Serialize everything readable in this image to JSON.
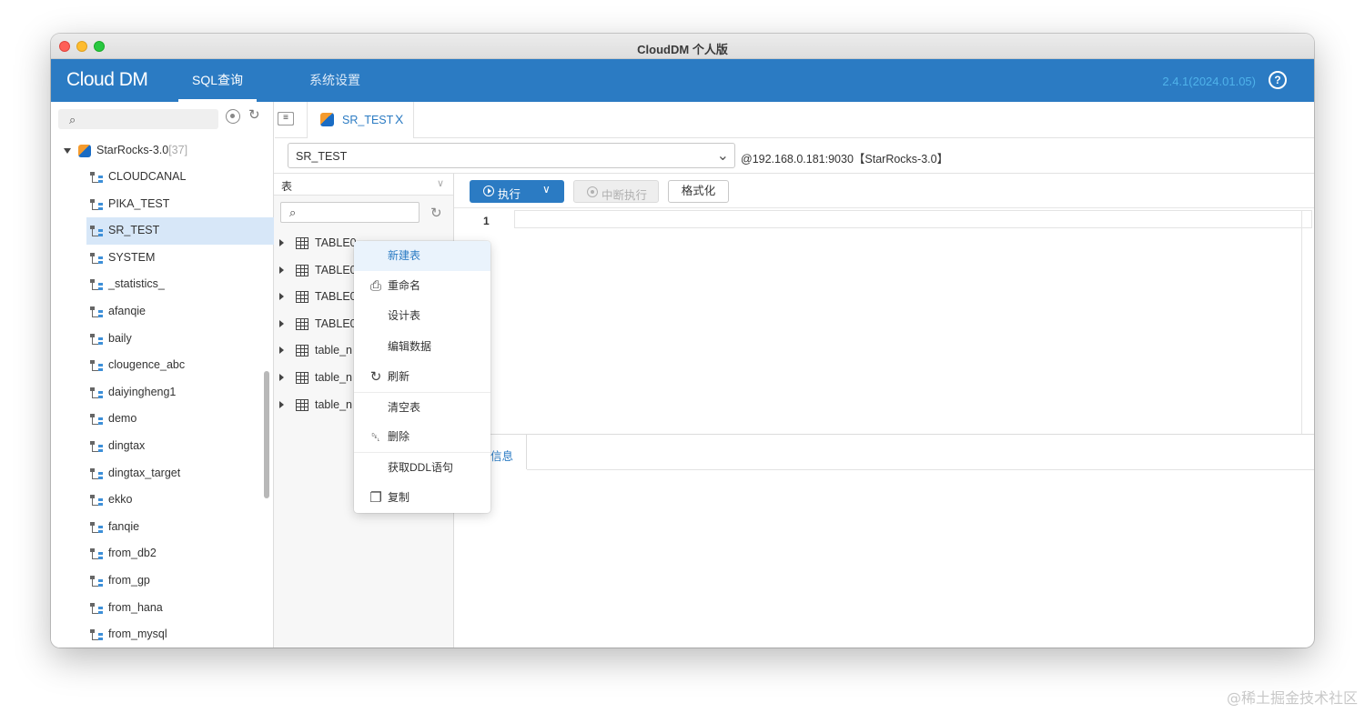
{
  "window": {
    "title": "CloudDM 个人版"
  },
  "header": {
    "logo": "Cloud DM",
    "tabs": [
      {
        "label": "SQL查询",
        "active": true
      },
      {
        "label": "系统设置",
        "active": false
      }
    ],
    "version": "2.4.1(2024.01.05)",
    "help_icon": "?"
  },
  "left_panel": {
    "search_icon": "search-icon",
    "root": {
      "name": "StarRocks-3.0",
      "count": "[37]"
    },
    "databases": [
      "CLOUDCANAL",
      "PIKA_TEST",
      "SR_TEST",
      "SYSTEM",
      "_statistics_",
      "afanqie",
      "baily",
      "clougence_abc",
      "daiyingheng1",
      "demo",
      "dingtax",
      "dingtax_target",
      "ekko",
      "fanqie",
      "from_db2",
      "from_gp",
      "from_hana",
      "from_mysql"
    ],
    "selected_database": "SR_TEST"
  },
  "query_tab": {
    "label": "SR_TEST",
    "close": "X"
  },
  "db_select": {
    "value": "SR_TEST",
    "connection": "@192.168.0.181:9030【StarRocks-3.0】"
  },
  "table_panel": {
    "type_select": "表",
    "tables": [
      "TABLE0",
      "TABLE0",
      "TABLE0",
      "TABLE0",
      "table_n",
      "table_n",
      "table_n"
    ],
    "first_table_partial": "TABLE0"
  },
  "toolbar": {
    "execute": "执行",
    "stop": "中断执行",
    "format": "格式化"
  },
  "editor": {
    "line_number": "1"
  },
  "result": {
    "tab_label": "信息"
  },
  "context_menu": {
    "items": [
      {
        "label": "新建表",
        "icon": "",
        "active": true
      },
      {
        "label": "重命名",
        "icon": "rename-icon"
      },
      {
        "label": "设计表",
        "icon": ""
      },
      {
        "label": "编辑数据",
        "icon": ""
      },
      {
        "label": "刷新",
        "icon": "refresh-icon"
      },
      {
        "label": "清空表",
        "icon": "",
        "separator": true
      },
      {
        "label": "删除",
        "icon": "trash-icon"
      },
      {
        "label": "获取DDL语句",
        "icon": "",
        "separator": true
      },
      {
        "label": "复制",
        "icon": "copy-icon"
      }
    ]
  },
  "watermark": "@稀土掘金技术社区",
  "colors": {
    "brand": "#2b7bc3",
    "version": "#4fb2ea",
    "selected_row": "#d7e7f8"
  }
}
